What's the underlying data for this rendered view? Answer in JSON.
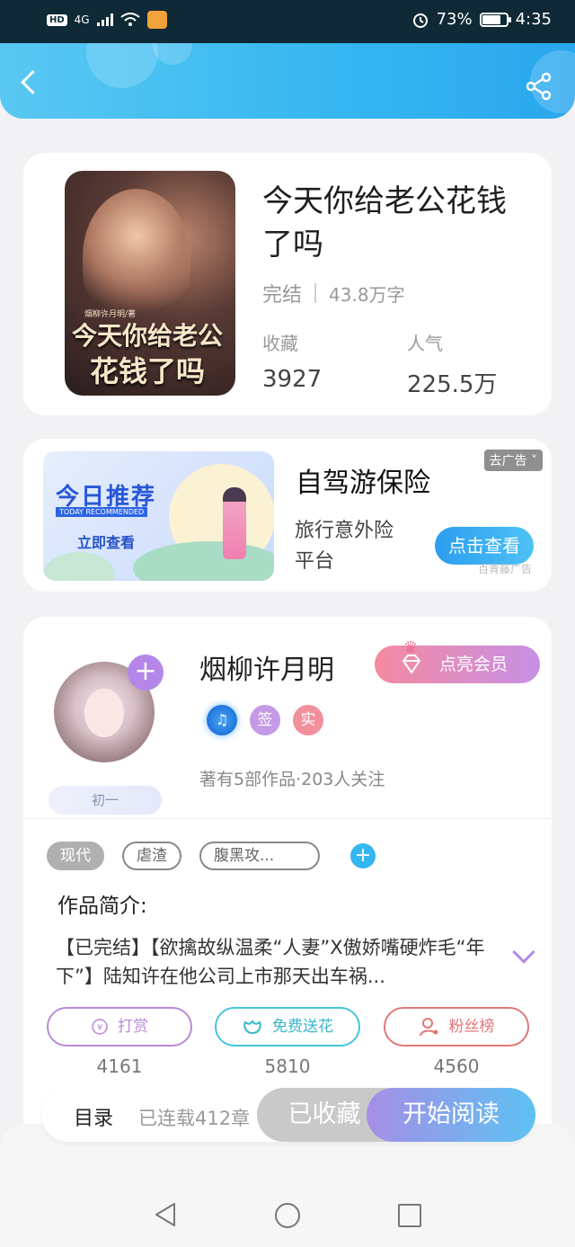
{
  "status_bar": {
    "network": "4G",
    "battery_percent": "73%",
    "battery_level": 0.73,
    "time": "4:35"
  },
  "header": {
    "back_icon": "chevron-left-icon",
    "share_icon": "share-icon"
  },
  "book": {
    "cover_author_text": "烟柳许月明/著",
    "cover_title_line1": "今天你给老公",
    "cover_title_line2": "花钱了吗",
    "title": "今天你给老公花钱了吗",
    "status": "完结",
    "word_count": "43.8万字",
    "stats": [
      {
        "label": "收藏",
        "value": "3927"
      },
      {
        "label": "人气",
        "value": "225.5万"
      }
    ]
  },
  "ad": {
    "banner_title": "今日推荐",
    "banner_subtitle": "TODAY RECOMMENDED",
    "banner_cta": "立即查看",
    "title": "自驾游保险",
    "description": "旅行意外险平台",
    "close_label": "去广告",
    "cta_label": "点击查看",
    "source": "百青藤广告"
  },
  "author": {
    "name": "烟柳许月明",
    "level": "初一",
    "vip_label": "点亮会员",
    "badges": [
      "♫",
      "签",
      "实"
    ],
    "info": "著有5部作品·203人关注"
  },
  "tags": [
    "现代",
    "虐渣",
    "腹黑攻..."
  ],
  "intro": {
    "title": "作品简介:",
    "text": "【已完结】【欲擒故纵温柔“人妻”X傲娇嘴硬炸毛“年下”】陆知许在他公司上市那天出车祸..."
  },
  "actions": [
    {
      "label": "打赏",
      "count": "4161",
      "icon": "yen-coin-icon"
    },
    {
      "label": "免费送花",
      "count": "5810",
      "icon": "flower-icon"
    },
    {
      "label": "粉丝榜",
      "count": "4560",
      "icon": "fans-user-icon"
    }
  ],
  "bottom_bar": {
    "toc_label": "目录",
    "chapters_text": "已连载412章",
    "collected_label": "已收藏",
    "read_label": "开始阅读"
  },
  "colors": {
    "header_start": "#59c8f2",
    "header_end": "#2aa7ee",
    "read_button_start": "#a58ee6",
    "read_button_end": "#5dc2f2"
  }
}
